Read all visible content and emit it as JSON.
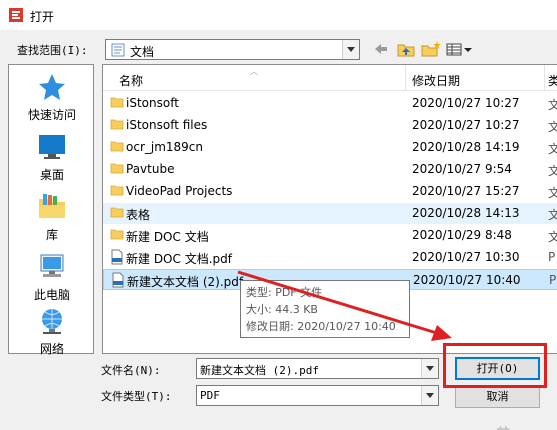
{
  "window": {
    "title": "打开"
  },
  "lookin": {
    "label": "查找范围(I):",
    "value": "文档"
  },
  "places": [
    {
      "label": "快速访问",
      "icon": "star-icon"
    },
    {
      "label": "桌面",
      "icon": "desktop-icon"
    },
    {
      "label": "库",
      "icon": "library-icon"
    },
    {
      "label": "此电脑",
      "icon": "computer-icon"
    },
    {
      "label": "网络",
      "icon": "network-icon"
    }
  ],
  "columns": {
    "name": "名称",
    "date": "修改日期",
    "type": "类"
  },
  "files": [
    {
      "name": "iStonsoft",
      "date": "2020/10/27 10:27",
      "type": "文",
      "kind": "folder"
    },
    {
      "name": "iStonsoft files",
      "date": "2020/10/27 10:27",
      "type": "文",
      "kind": "folder"
    },
    {
      "name": "ocr_jm189cn",
      "date": "2020/10/28 14:19",
      "type": "文",
      "kind": "folder"
    },
    {
      "name": "Pavtube",
      "date": "2020/10/27 9:54",
      "type": "文",
      "kind": "folder"
    },
    {
      "name": "VideoPad Projects",
      "date": "2020/10/27 15:27",
      "type": "文",
      "kind": "folder"
    },
    {
      "name": "表格",
      "date": "2020/10/28 14:13",
      "type": "文",
      "kind": "folder"
    },
    {
      "name": "新建 DOC 文档",
      "date": "2020/10/29 8:48",
      "type": "文",
      "kind": "folder"
    },
    {
      "name": "新建 DOC 文档.pdf",
      "date": "2020/10/27 10:30",
      "type": "P",
      "kind": "pdf"
    },
    {
      "name": "新建文本文档 (2).pdf",
      "date": "2020/10/27 10:40",
      "type": "P",
      "kind": "pdf"
    }
  ],
  "tooltip": {
    "type": "类型: PDF 文件",
    "size": "大小: 44.3 KB",
    "modified": "修改日期: 2020/10/27 10:40"
  },
  "filename": {
    "label": "文件名(N):",
    "value": "新建文本文档 (2).pdf"
  },
  "filetype": {
    "label": "文件类型(T):",
    "value": "PDF"
  },
  "buttons": {
    "open": "打开(O)",
    "cancel": "取消"
  },
  "colors": {
    "selection": "#cce8ff",
    "hover": "#e5f3ff",
    "folder": "#f7cd5b",
    "annotation": "#e02020"
  }
}
